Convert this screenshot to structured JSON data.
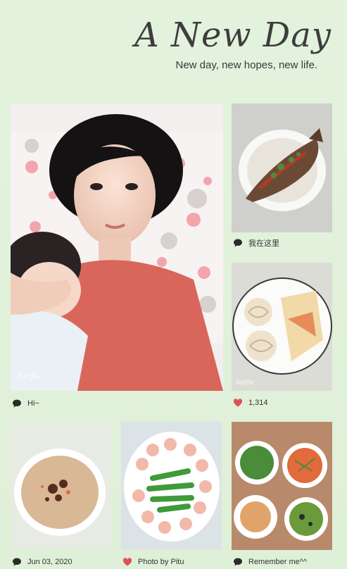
{
  "header": {
    "title": "A New Day",
    "subtitle": "New day, new hopes, new life."
  },
  "tiles": [
    {
      "caption": "Hi~",
      "icon": "comment-icon"
    },
    {
      "caption": "我在这里",
      "icon": "comment-icon"
    },
    {
      "caption": "1,314",
      "icon": "heart-icon"
    },
    {
      "caption": "Jun 03, 2020",
      "icon": "comment-icon"
    },
    {
      "caption": "Photo by Pitu",
      "icon": "heart-icon"
    },
    {
      "caption": "Remember me^^",
      "icon": "comment-icon"
    }
  ],
  "colors": {
    "background": "#dff0d8",
    "text": "#333333",
    "heart": "#e0505a"
  }
}
